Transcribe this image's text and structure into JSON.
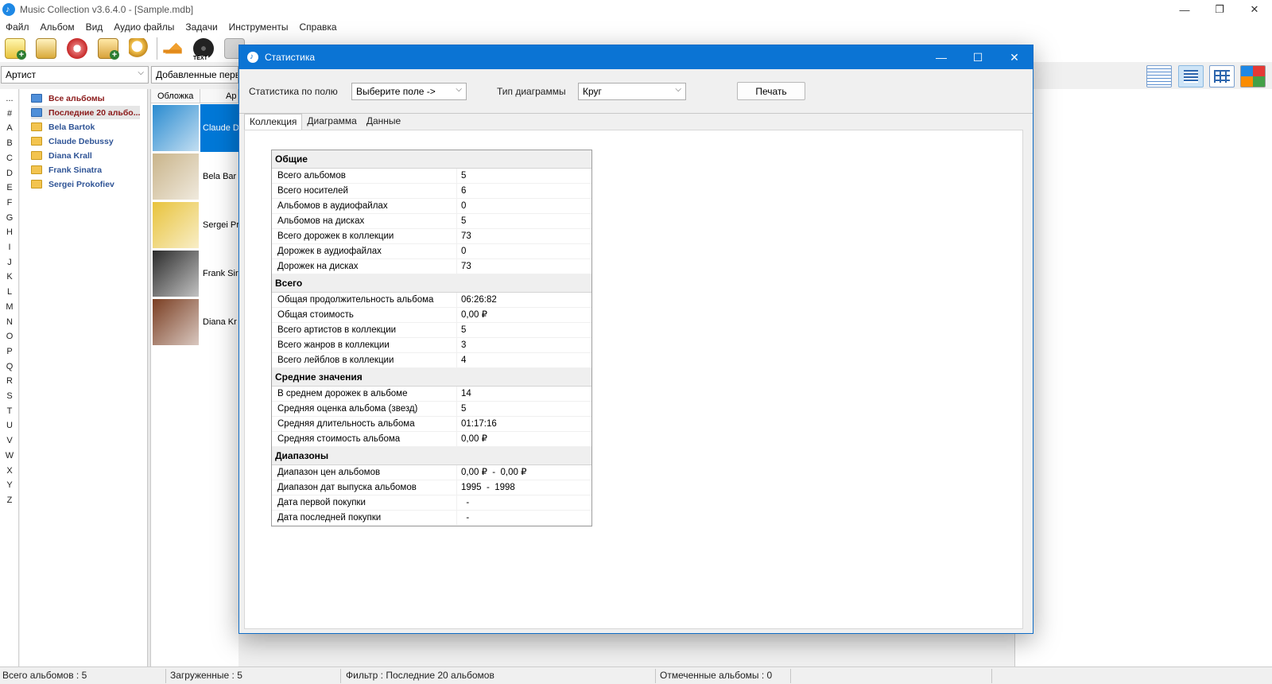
{
  "app": {
    "title": "Music Collection v3.6.4.0 - [Sample.mdb]",
    "window_controls": [
      "—",
      "❐",
      "✕"
    ]
  },
  "menu": [
    "Файл",
    "Альбом",
    "Вид",
    "Аудио файлы",
    "Задачи",
    "Инструменты",
    "Справка"
  ],
  "toolbar_icons": [
    "add-album-icon",
    "add-from-db-icon",
    "add-from-cd-icon",
    "add-from-disc-icon",
    "search-icon",
    "eject-icon",
    "text-disc-icon"
  ],
  "toolbar_text_icon_label": "TEXT",
  "filter": {
    "field_value": "Артист",
    "sort_value": "Добавленные первые"
  },
  "letters": [
    "...",
    "#",
    "A",
    "B",
    "C",
    "D",
    "E",
    "F",
    "G",
    "H",
    "I",
    "J",
    "K",
    "L",
    "M",
    "N",
    "O",
    "P",
    "Q",
    "R",
    "S",
    "T",
    "U",
    "V",
    "W",
    "X",
    "Y",
    "Z"
  ],
  "tree": [
    {
      "label": "Все альбомы",
      "style": "red",
      "icon": "blue"
    },
    {
      "label": "Последние 20 альбо...",
      "style": "red",
      "icon": "blue",
      "selected": true
    },
    {
      "label": "Bela Bartok",
      "style": "blue",
      "icon": "folder"
    },
    {
      "label": "Claude Debussy",
      "style": "blue",
      "icon": "folder"
    },
    {
      "label": "Diana Krall",
      "style": "blue",
      "icon": "folder"
    },
    {
      "label": "Frank Sinatra",
      "style": "blue",
      "icon": "folder"
    },
    {
      "label": "Sergei Prokofiev",
      "style": "blue",
      "icon": "folder"
    }
  ],
  "albums": {
    "columns": [
      "Обложка",
      "Ар"
    ],
    "rows": [
      {
        "name": "Claude D",
        "cover_color": "#2a8bd0",
        "selected": true
      },
      {
        "name": "Bela Bar",
        "cover_color": "#c9b48a"
      },
      {
        "name": "Sergei Pr",
        "cover_color": "#e8c33c"
      },
      {
        "name": "Frank Sir",
        "cover_color": "#2b2b2b"
      },
      {
        "name": "Diana Kr",
        "cover_color": "#7a3e22"
      }
    ]
  },
  "dialog": {
    "title": "Статистика",
    "field_label": "Статистика по полю",
    "field_value": "Выберите поле ->",
    "chart_type_label": "Тип диаграммы",
    "chart_type_value": "Круг",
    "print_button": "Печать",
    "tabs": [
      "Коллекция",
      "Диаграмма",
      "Данные"
    ],
    "sections": [
      {
        "title": "Общие",
        "rows": [
          [
            "Всего альбомов",
            "5"
          ],
          [
            "Всего носителей",
            "6"
          ],
          [
            "Альбомов в аудиофайлах",
            "0"
          ],
          [
            "Альбомов на дисках",
            "5"
          ],
          [
            "Всего дорожек в коллекции",
            "73"
          ],
          [
            "Дорожек в аудиофайлах",
            "0"
          ],
          [
            "Дорожек на дисках",
            "73"
          ]
        ]
      },
      {
        "title": "Всего",
        "rows": [
          [
            "Общая продолжительность альбома",
            "06:26:82"
          ],
          [
            "Общая стоимость",
            "0,00 ₽"
          ],
          [
            "Всего артистов в коллекции",
            "5"
          ],
          [
            "Всего жанров в коллекции",
            "3"
          ],
          [
            "Всего лейблов в коллекции",
            "4"
          ]
        ]
      },
      {
        "title": "Средние значения",
        "rows": [
          [
            "В среднем дорожек в альбоме",
            "14"
          ],
          [
            "Средняя оценка альбома (звезд)",
            "5"
          ],
          [
            "Средняя длительность альбома",
            "01:17:16"
          ],
          [
            "Средняя стоимость альбома",
            "0,00 ₽"
          ]
        ]
      },
      {
        "title": "Диапазоны",
        "rows": [
          [
            "Диапазон цен альбомов",
            "0,00 ₽  -  0,00 ₽"
          ],
          [
            "Диапазон дат выпуска альбомов",
            "1995  -  1998"
          ],
          [
            "Дата первой покупки",
            "  -"
          ],
          [
            "Дата последней покупки",
            "  -"
          ]
        ]
      }
    ]
  },
  "status": [
    "Всего альбомов : 5",
    "Загруженные : 5",
    "Фильтр : Последние 20 альбомов",
    "Отмеченные альбомы : 0"
  ]
}
